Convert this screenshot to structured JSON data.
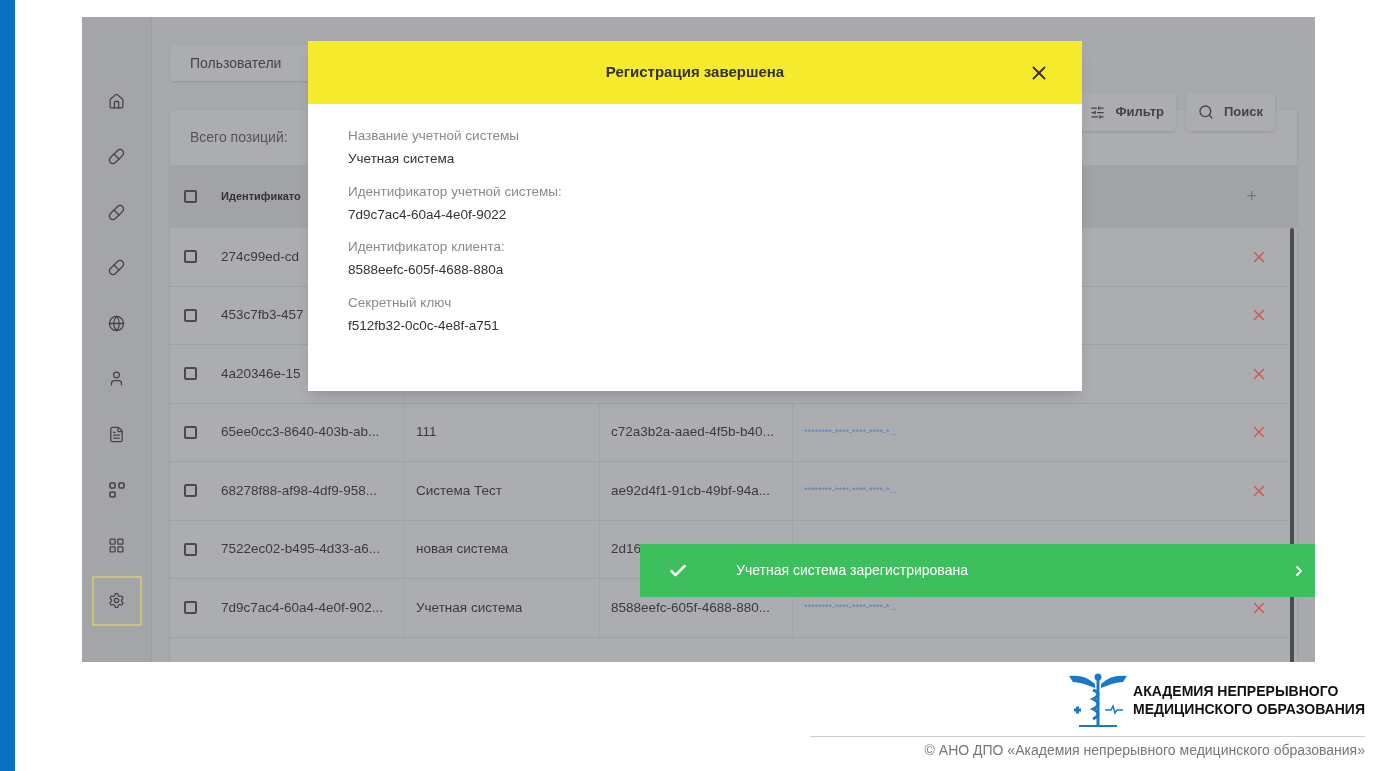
{
  "sidebar": {
    "items": [
      {
        "selected": false
      },
      {
        "selected": false
      },
      {
        "selected": false
      },
      {
        "selected": false
      },
      {
        "selected": false
      },
      {
        "selected": false
      },
      {
        "selected": false
      },
      {
        "selected": false
      },
      {
        "selected": false
      },
      {
        "selected": true
      }
    ]
  },
  "tab": {
    "label": "Пользователи"
  },
  "table": {
    "total": "Всего позиций:",
    "actions": [
      "Фильтр",
      "Поиск"
    ],
    "columns": [
      "Идентификато"
    ],
    "add": "+",
    "header_checked": false,
    "rows": [
      {
        "checked": false,
        "cells": [
          "274c99ed-cd"
        ]
      },
      {
        "checked": false,
        "cells": [
          "453c7fb3-457"
        ]
      },
      {
        "checked": false,
        "cells": [
          "4a20346e-15"
        ]
      },
      {
        "checked": false,
        "cells": [
          "65ee0cc3-8640-403b-ab...",
          "111",
          "c72a3b2a-aaed-4f5b-b40...",
          "********-****-****-****-*..."
        ]
      },
      {
        "checked": false,
        "cells": [
          "68278f88-af98-4df9-958...",
          "Система Тест",
          "ae92d4f1-91cb-49bf-94a...",
          "********-****-****-****-*..."
        ]
      },
      {
        "checked": false,
        "cells": [
          "7522ec02-b495-4d33-a6...",
          "новая система",
          "2d16"
        ]
      },
      {
        "checked": false,
        "cells": [
          "7d9c7ac4-60a4-4e0f-902...",
          "Учетная система",
          "8588eefc-605f-4688-880...",
          "********-****-****-****-*..."
        ]
      }
    ]
  },
  "dialog": {
    "title": "Регистрация завершена",
    "fields": [
      {
        "label": "Название учетной системы",
        "value": "Учетная система"
      },
      {
        "label": "Идентификатор учетной системы:",
        "value": "7d9c7ac4-60a4-4e0f-9022"
      },
      {
        "label": "Идентификатор клиента:",
        "value": "8588eefc-605f-4688-880a"
      },
      {
        "label": "Секретный ключ",
        "value": "f512fb32-0c0c-4e8f-a751"
      }
    ]
  },
  "toast": {
    "message": "Учетная система зарегистрирована"
  },
  "footer": {
    "logo_lines": [
      "АКАДЕМИЯ НЕПРЕРЫВНОГО",
      "МЕДИЦИНСКОГО ОБРАЗОВАНИЯ"
    ],
    "copyright": "© АНО ДПО «Академия непрерывного медицинского образования»"
  }
}
